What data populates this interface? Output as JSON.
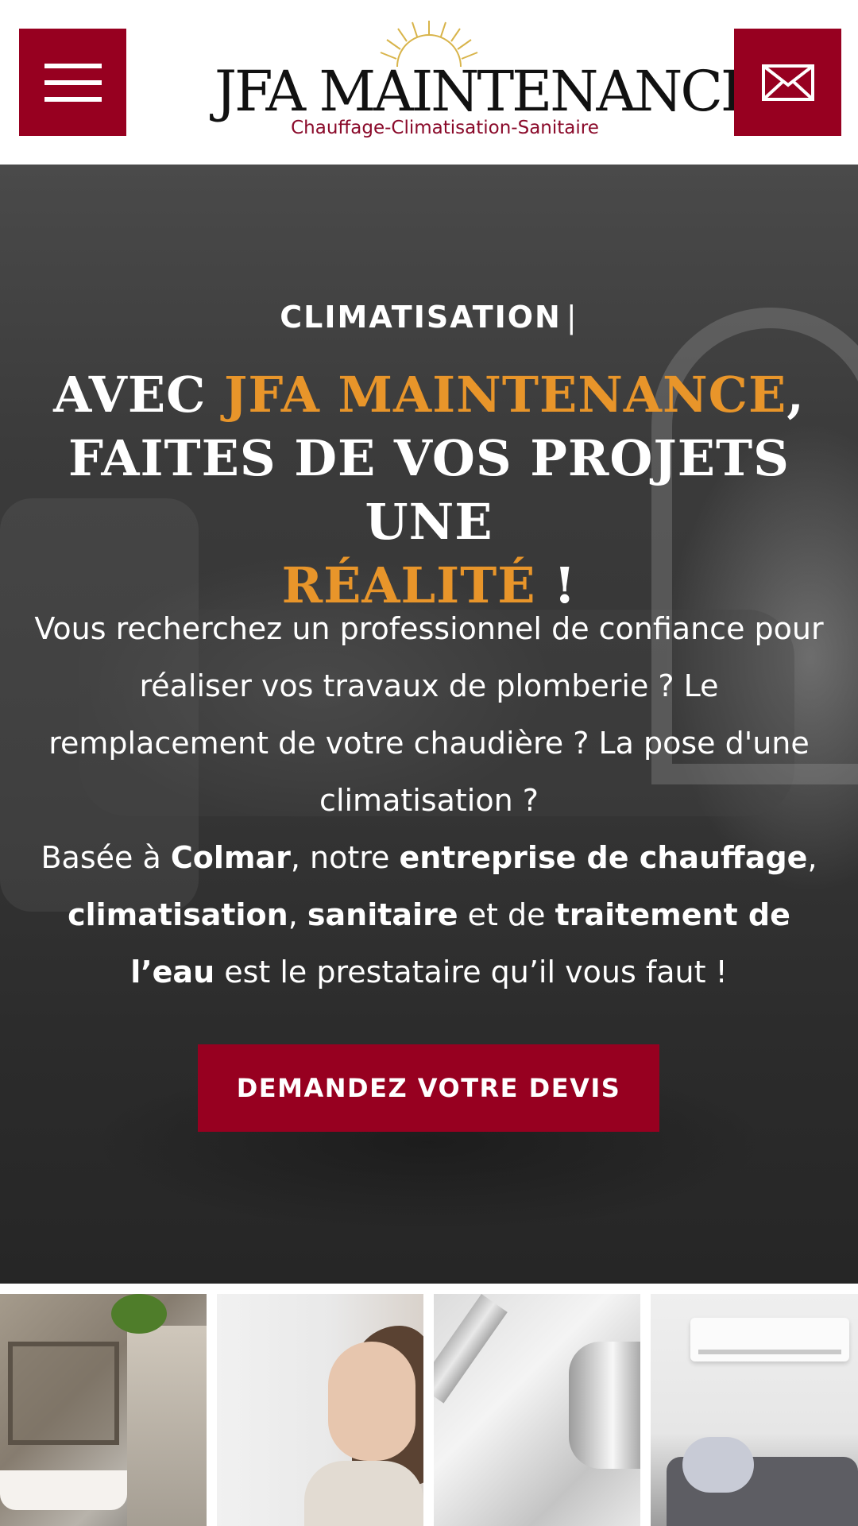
{
  "header": {
    "menu_label": "Menu",
    "brand": "JFA MAINTENANCE",
    "tagline": "Chauffage-Climatisation-Sanitaire",
    "contact_label": "Contact"
  },
  "hero": {
    "eyebrow": "CLIMATISATION",
    "eyebrow_caret": "|",
    "headline": {
      "part1": "AVEC ",
      "brand": "JFA MAINTENANCE",
      "part2": ",",
      "part3": "FAITES DE VOS PROJETS UNE",
      "highlight": "RÉALITÉ",
      "end": " !"
    },
    "intro": {
      "line1": "Vous recherchez un professionnel de confiance pour réaliser vos travaux de plomberie ? Le remplacement de votre chaudière ? La pose d'une climatisation ?",
      "p2_prefix": "Basée à ",
      "city": "Colmar",
      "p2_mid": ", notre ",
      "kw1": "entreprise de chauffage",
      "comma1": ", ",
      "kw2": "climatisation",
      "comma2": ", ",
      "kw3": "sanitaire",
      "p2_and": " et de ",
      "kw4": "traitement de l’eau",
      "p2_end": " est le prestataire qu’il vous faut !"
    },
    "cta_label": "DEMANDEZ VOTRE DEVIS"
  },
  "colors": {
    "brand_red": "#970020",
    "accent_orange": "#e8952a",
    "tagline_red": "#8a0a2a"
  },
  "gallery": {
    "tiles": [
      {
        "subject": "bathroom"
      },
      {
        "subject": "woman-profile"
      },
      {
        "subject": "faucet"
      },
      {
        "subject": "air-conditioner"
      }
    ]
  }
}
